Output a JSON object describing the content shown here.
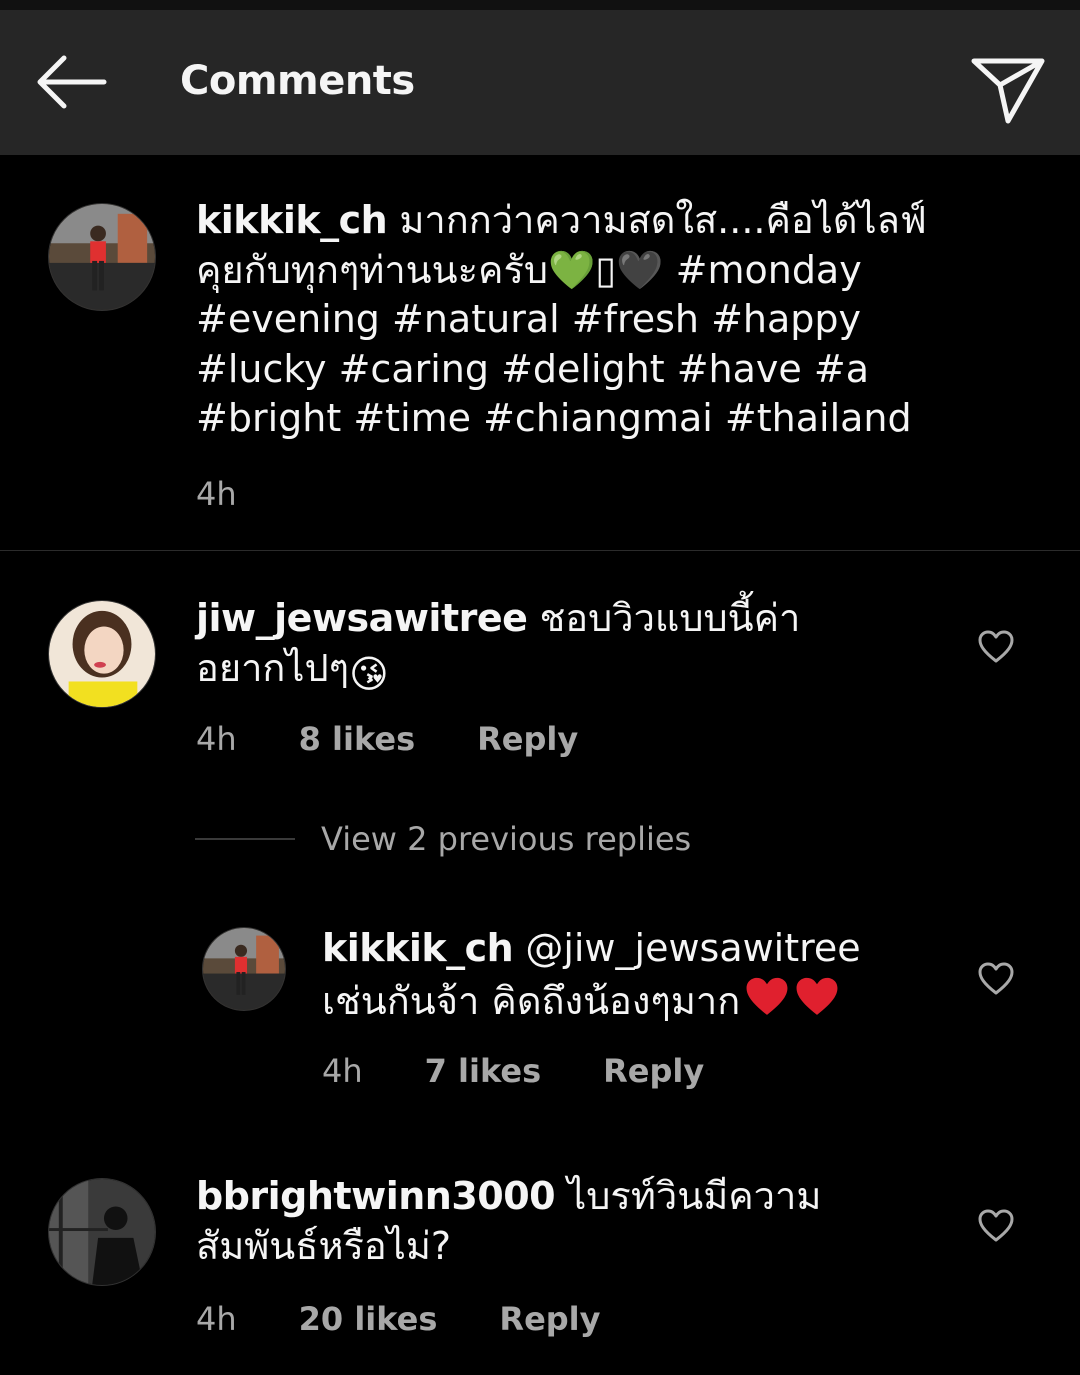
{
  "header": {
    "title": "Comments",
    "back_icon": "arrow-left-icon",
    "share_icon": "paper-plane-icon"
  },
  "caption": {
    "username": "kikkik_ch",
    "text_thai": "มากกว่าความสดใส....คือได้ไลฟ์คุยกับทุกๆท่านนะครับ",
    "emoji_tail": "💚▯🖤",
    "hashtags": "#monday #evening #natural #fresh #happy #lucky #caring #delight #have #a #bright #time #chiangmai #thailand",
    "time": "4h"
  },
  "comments": [
    {
      "username": "jiw_jewsawitree",
      "text": "ชอบวิวแบบนี้ค่า อยากไปๆ",
      "emoji": "😘",
      "time": "4h",
      "likes": "8 likes",
      "reply": "Reply"
    },
    {
      "username": "bbrightwinn3000",
      "text": "ไบรท์วินมีความสัมพันธ์หรือไม่?",
      "time": "4h",
      "likes": "20 likes",
      "reply": "Reply"
    }
  ],
  "view_replies": "View 2 previous replies",
  "reply_item": {
    "username": "kikkik_ch",
    "mention": "@jiw_jewsawitree",
    "text": "เช่นกันจ้า คิดถึงน้องๆมาก",
    "time": "4h",
    "likes": "7 likes",
    "reply": "Reply"
  },
  "colors": {
    "background": "#000000",
    "header": "#262626",
    "text": "#f5f5f5",
    "secondary": "#a8a8a8",
    "heart_red": "#e0202e",
    "heart_green": "#4caf50"
  }
}
